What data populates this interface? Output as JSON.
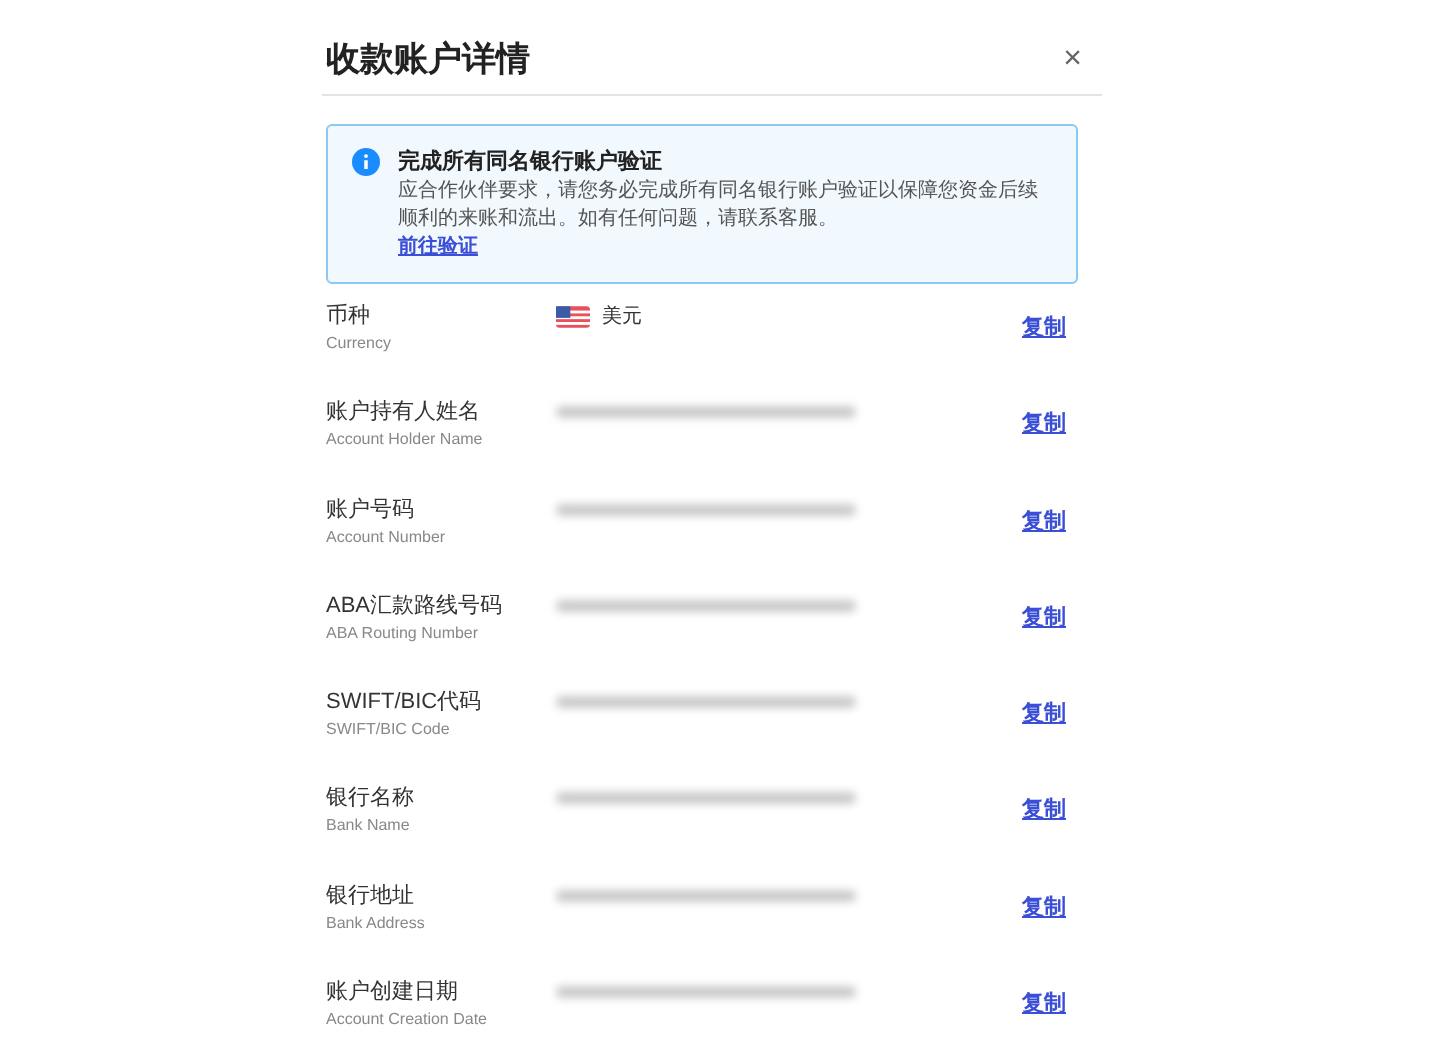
{
  "dialog": {
    "title": "收款账户详情",
    "close": "×"
  },
  "alert": {
    "title": "完成所有同名银行账户验证",
    "body": "应合作伙伴要求，请您务必完成所有同名银行账户验证以保障您资金后续顺利的来账和流出。如有任何问题，请联系客服。",
    "link": "前往验证"
  },
  "fields": [
    {
      "label": "币种",
      "sublabel": "Currency",
      "value": {
        "kind": "currency",
        "text": "美元"
      },
      "action": "复制"
    },
    {
      "label": "账户持有人姓名",
      "sublabel": "Account Holder Name",
      "value": {
        "kind": "blurred"
      },
      "action": "复制"
    },
    {
      "label": "账户号码",
      "sublabel": "Account Number",
      "value": {
        "kind": "blurred"
      },
      "action": "复制"
    },
    {
      "label": "ABA汇款路线号码",
      "sublabel": "ABA Routing Number",
      "value": {
        "kind": "blurred"
      },
      "action": "复制"
    },
    {
      "label": "SWIFT/BIC代码",
      "sublabel": "SWIFT/BIC Code",
      "value": {
        "kind": "blurred"
      },
      "action": "复制"
    },
    {
      "label": "银行名称",
      "sublabel": "Bank Name",
      "value": {
        "kind": "blurred"
      },
      "action": "复制"
    },
    {
      "label": "银行地址",
      "sublabel": "Bank Address",
      "value": {
        "kind": "blurred"
      },
      "action": "复制"
    },
    {
      "label": "账户创建日期",
      "sublabel": "Account Creation Date",
      "value": {
        "kind": "blurred"
      },
      "action": "复制"
    }
  ]
}
